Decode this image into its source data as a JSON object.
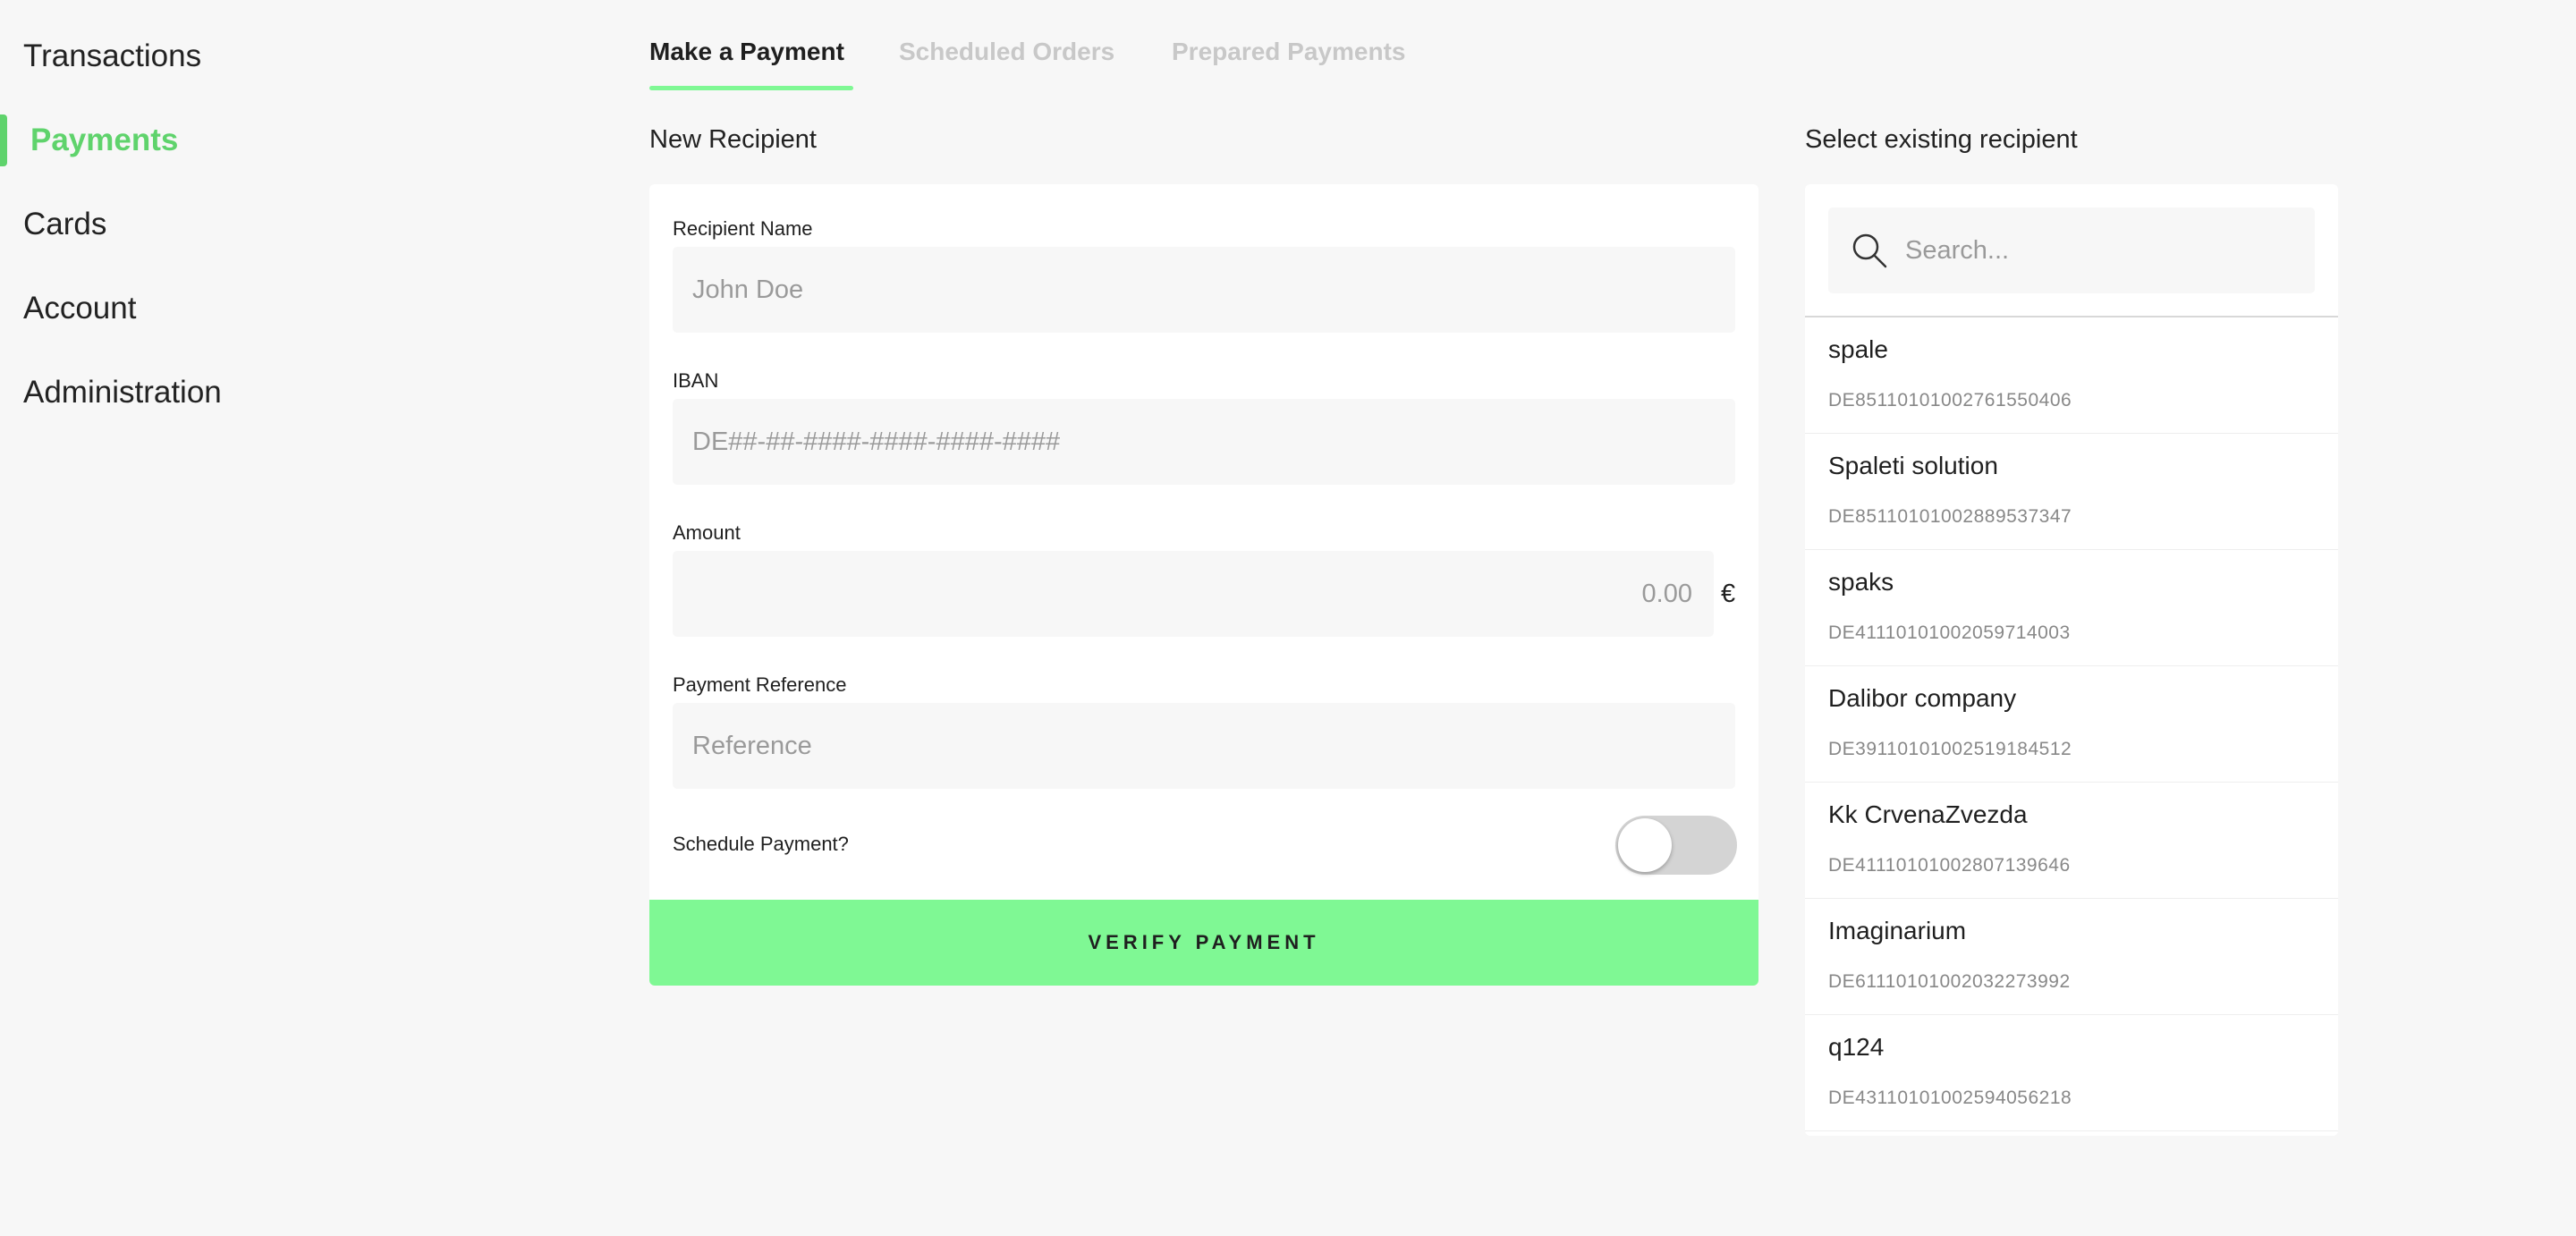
{
  "sidebar": {
    "items": [
      {
        "label": "Transactions"
      },
      {
        "label": "Payments"
      },
      {
        "label": "Cards"
      },
      {
        "label": "Account"
      },
      {
        "label": "Administration"
      }
    ],
    "active_index": 1
  },
  "tabs": [
    {
      "label": "Make a Payment"
    },
    {
      "label": "Scheduled Orders"
    },
    {
      "label": "Prepared Payments"
    }
  ],
  "form": {
    "title": "New Recipient",
    "recipient_name": {
      "label": "Recipient Name",
      "placeholder": "John Doe",
      "value": ""
    },
    "iban": {
      "label": "IBAN",
      "placeholder": "DE##-##-####-####-####-####",
      "value": ""
    },
    "amount": {
      "label": "Amount",
      "placeholder": "0.00",
      "value": "",
      "currency": "€"
    },
    "reference": {
      "label": "Payment Reference",
      "placeholder": "Reference",
      "value": ""
    },
    "schedule": {
      "label": "Schedule Payment?",
      "enabled": false
    },
    "verify_label": "VERIFY PAYMENT"
  },
  "recipients": {
    "title": "Select existing recipient",
    "search_placeholder": "Search...",
    "items": [
      {
        "name": "spale",
        "iban": "DE85110101002761550406"
      },
      {
        "name": "Spaleti solution",
        "iban": "DE85110101002889537347"
      },
      {
        "name": "spaks",
        "iban": "DE41110101002059714003"
      },
      {
        "name": "Dalibor company",
        "iban": "DE39110101002519184512"
      },
      {
        "name": "Kk CrvenaZvezda",
        "iban": "DE41110101002807139646"
      },
      {
        "name": "Imaginarium",
        "iban": "DE61110101002032273992"
      },
      {
        "name": "q124",
        "iban": "DE43110101002594056218"
      }
    ]
  },
  "colors": {
    "accent": "#5fd36c",
    "button": "#7ff894",
    "background": "#f7f7f7",
    "muted_tab": "#c8c8c8"
  },
  "icons": {
    "search": "search-icon"
  }
}
